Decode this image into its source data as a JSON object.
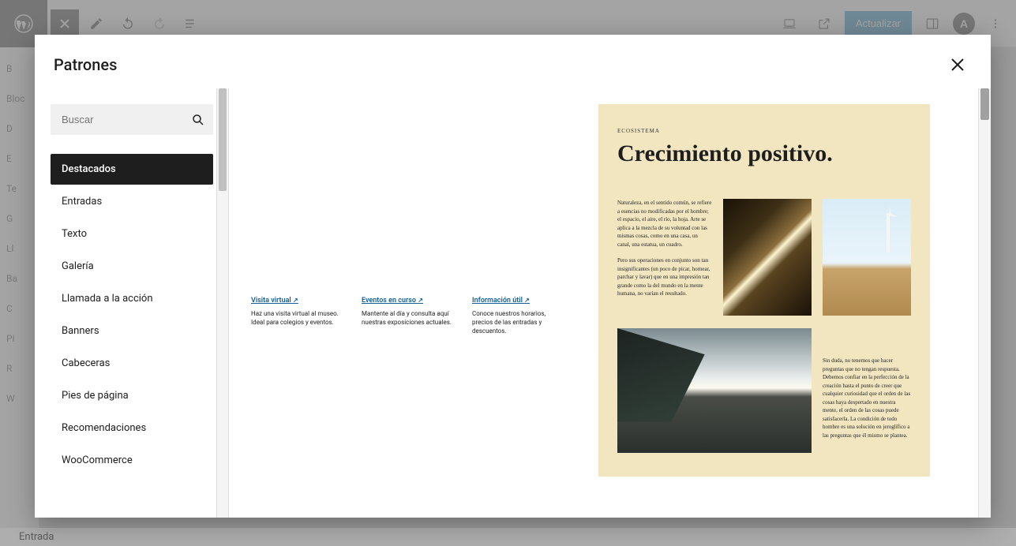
{
  "toolbar": {
    "update_label": "Actualizar"
  },
  "bg_sidebar_items": [
    "B",
    "Bloc",
    "D",
    "E",
    "Te",
    "G",
    "Ll",
    "Ba",
    "C",
    "Pi",
    "R",
    "W"
  ],
  "bg_footer": "Entrada",
  "modal": {
    "title": "Patrones",
    "search_placeholder": "Buscar",
    "categories": [
      {
        "label": "Destacados",
        "active": true
      },
      {
        "label": "Entradas",
        "active": false
      },
      {
        "label": "Texto",
        "active": false
      },
      {
        "label": "Galería",
        "active": false
      },
      {
        "label": "Llamada a la acción",
        "active": false
      },
      {
        "label": "Banners",
        "active": false
      },
      {
        "label": "Cabeceras",
        "active": false
      },
      {
        "label": "Pies de página",
        "active": false
      },
      {
        "label": "Recomendaciones",
        "active": false
      },
      {
        "label": "WooCommerce",
        "active": false
      }
    ]
  },
  "pattern_links": {
    "cols": [
      {
        "title": "Visita virtual",
        "arrow": "↗",
        "desc": "Haz una visita virtual al museo. Ideal para colegios y eventos."
      },
      {
        "title": "Eventos en curso",
        "arrow": "↗",
        "desc": "Mantente al día y consulta aquí nuestras exposiciones actuales."
      },
      {
        "title": "Información útil",
        "arrow": "↗",
        "desc": "Conoce nuestros horarios, precios de las entradas y descuentos."
      }
    ]
  },
  "pattern_growth": {
    "eyebrow": "ECOSISTEMA",
    "title": "Crecimiento positivo.",
    "p1": "Naturaleza, en el sentido común, se refiere a esencias no modificadas por el hombre; el espacio, el aire, el río, la hoja. Arte se aplica a la mezcla de su voluntad con las mismas cosas, como en una casa, un canal, una estatua, un cuadro.",
    "p2": "Pero sus operaciones en conjunto son tan insignificantes (un poco de picar, hornear, parchar y lavar) que en una impresión tan grande como la del mundo en la mente humana, no varían el resultado.",
    "p3": "Sin duda, no tenemos que hacer preguntas que no tengan respuesta. Debemos confiar en la perfección de la creación hasta el punto de creer que cualquier curiosidad que el orden de las cosas haya despertado en nuestra mente, el orden de las cosas puede satisfacerla. La condición de todo hombre es una solución en jeroglífico a las preguntas que él mismo se plantea."
  }
}
